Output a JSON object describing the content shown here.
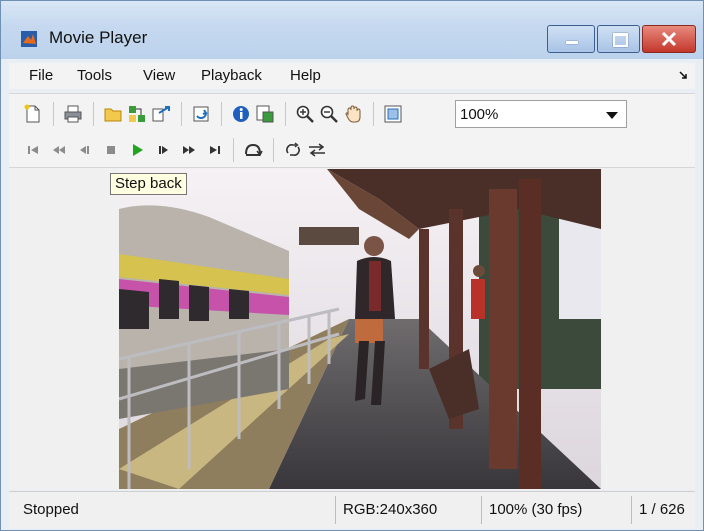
{
  "window": {
    "title": "Movie Player"
  },
  "menu": {
    "items": [
      "File",
      "Tools",
      "View",
      "Playback",
      "Help"
    ]
  },
  "toolbar": {
    "zoom_value": "100%"
  },
  "tooltip": {
    "text": "Step back"
  },
  "status": {
    "state": "Stopped",
    "format": "RGB:240x360",
    "zoom_fps": "100% (30 fps)",
    "frame": "1 / 626"
  },
  "colors": {
    "play_green": "#1fa51f",
    "titlebar": "#c5d8ef",
    "tooltip_bg": "#ffffe1",
    "close_red": "#c4372b"
  },
  "icons": [
    "new-window-icon",
    "print-icon",
    "open-folder-icon",
    "connect-simulink-icon",
    "export-icon",
    "sync-icon",
    "info-icon",
    "properties-icon",
    "zoom-in-icon",
    "zoom-out-icon",
    "pan-hand-icon",
    "fit-to-window-icon",
    "go-to-first-icon",
    "rewind-icon",
    "step-back-icon",
    "stop-icon",
    "play-icon",
    "step-forward-icon",
    "fast-forward-icon",
    "go-to-last-icon",
    "jump-to-icon",
    "repeat-icon",
    "forward-backward-icon"
  ]
}
